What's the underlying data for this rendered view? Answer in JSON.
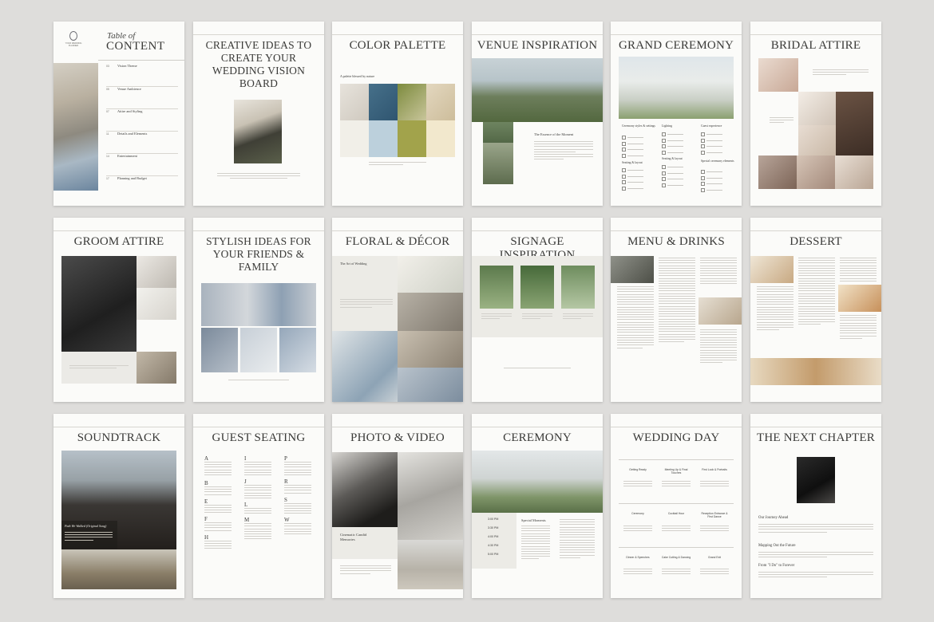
{
  "pages": [
    {
      "id": "toc",
      "logo_text": "YOUR WEDDING PLANNER",
      "title_italic": "Table of",
      "title": "CONTENT",
      "entries": [
        {
          "num": "03",
          "label": "Vision Theme"
        },
        {
          "num": "05",
          "label": "Venue Ambience"
        },
        {
          "num": "07",
          "label": "Attire and Styling"
        },
        {
          "num": "11",
          "label": "Details and Elements"
        },
        {
          "num": "14",
          "label": "Entertainment"
        },
        {
          "num": "17",
          "label": "Planning and Budget"
        }
      ]
    },
    {
      "id": "creative",
      "title": "CREATIVE IDEAS TO CREATE YOUR WEDDING VISION BOARD"
    },
    {
      "id": "palette",
      "title": "COLOR PALETTE",
      "subtitle": "A palette blessed by nature",
      "swatch_colors": [
        "#f1efe8",
        "#bcd0dc",
        "#a2a34b",
        "#f2e8cd"
      ]
    },
    {
      "id": "venue",
      "title": "VENUE INSPIRATION",
      "subtitle": "The Essence of the Moment"
    },
    {
      "id": "grand",
      "title": "GRAND CEREMONY",
      "columns": [
        "Ceremony styles & settings",
        "Lighting",
        "Guest experience"
      ],
      "columns2": [
        "Seating & layout",
        "Seating & layout",
        "Special ceremony elements"
      ]
    },
    {
      "id": "bridal",
      "title": "BRIDAL ATTIRE"
    },
    {
      "id": "groom",
      "title": "GROOM ATTIRE"
    },
    {
      "id": "stylish",
      "title": "STYLISH IDEAS FOR YOUR FRIENDS & FAMILY"
    },
    {
      "id": "floral",
      "title": "FLORAL & DÉCOR",
      "subtitle": "The Art of Wedding"
    },
    {
      "id": "signage",
      "title": "SIGNAGE INSPIRATION"
    },
    {
      "id": "menu",
      "title": "MENU & DRINKS"
    },
    {
      "id": "dessert",
      "title": "DESSERT"
    },
    {
      "id": "soundtrack",
      "title": "SOUNDTRACK",
      "song": "Path We Walked (Original Song)"
    },
    {
      "id": "seating",
      "title": "GUEST SEATING",
      "letters_col1": [
        "A",
        "B",
        "E",
        "F",
        "H"
      ],
      "letters_col2": [
        "I",
        "J",
        "L",
        "M"
      ],
      "letters_col3": [
        "P",
        "R",
        "S",
        "W"
      ]
    },
    {
      "id": "photo",
      "title": "PHOTO & VIDEO",
      "caption": "Cinematic Candid Memories"
    },
    {
      "id": "ceremony",
      "title": "CEREMONY",
      "subtitle": "Special Moments",
      "times": [
        "3:00 PM",
        "3:30 PM",
        "4:00 PM",
        "4:30 PM",
        "5:00 PM"
      ]
    },
    {
      "id": "wedding_day",
      "title": "WEDDING DAY",
      "slots": [
        "Getting Ready",
        "Meeting Up & Final Touches",
        "First Look & Portraits",
        "Ceremony",
        "Cocktail Hour",
        "Reception Entrance & First Dance",
        "Dinner & Speeches",
        "Cake Cutting & Dancing",
        "Grand Exit"
      ]
    },
    {
      "id": "next",
      "title": "THE NEXT CHAPTER",
      "headings": [
        "Our Journey Ahead",
        "Mapping Out the Future",
        "From \"I Do\" to Forever"
      ]
    }
  ]
}
